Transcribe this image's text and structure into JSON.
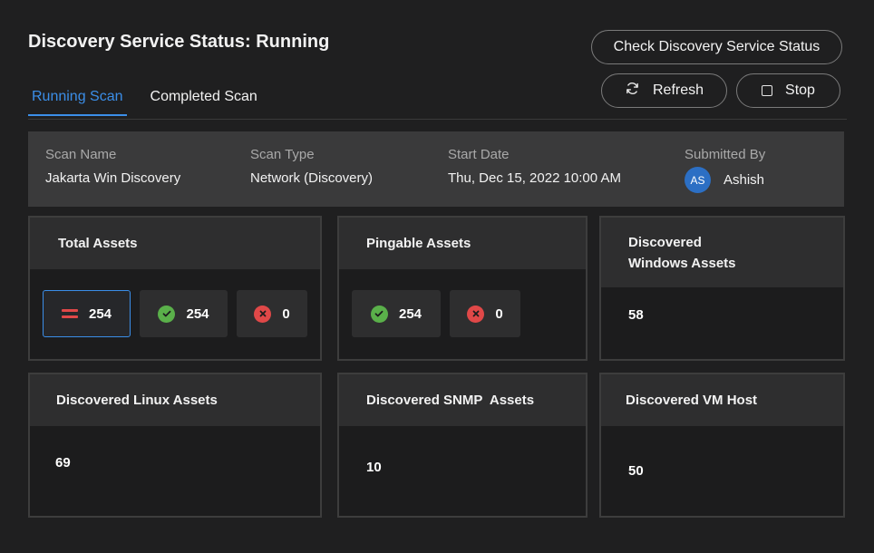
{
  "header": {
    "title": "Discovery Service Status: Running",
    "check_label": "Check Discovery Service Status",
    "refresh_label": "Refresh",
    "stop_label": "Stop"
  },
  "tabs": [
    {
      "label": "Running Scan",
      "active": true
    },
    {
      "label": "Completed Scan",
      "active": false
    }
  ],
  "scan_info": {
    "name_label": "Scan Name",
    "name_value": "Jakarta Win Discovery",
    "type_label": "Scan Type",
    "type_value": "Network (Discovery)",
    "date_label": "Start Date",
    "date_value": "Thu, Dec 15, 2022 10:00 AM",
    "submitted_label": "Submitted By",
    "submitted_initials": "AS",
    "submitted_value": "Ashish"
  },
  "cards": {
    "total": {
      "title": "Total Assets",
      "all": "254",
      "ok": "254",
      "failed": "0"
    },
    "pingable": {
      "title": "Pingable Assets",
      "ok": "254",
      "failed": "0"
    },
    "windows": {
      "title_line1": "Discovered",
      "title_line2": "Windows Assets",
      "value": "58"
    },
    "linux": {
      "title": "Discovered Linux Assets",
      "value": "69"
    },
    "snmp": {
      "title": "Discovered SNMP  Assets",
      "value": "10"
    },
    "vm": {
      "title": "Discovered VM Host",
      "value": "50"
    }
  },
  "colors": {
    "accent": "#3b8ee8",
    "ok": "#5ab04a",
    "error": "#e04848",
    "avatar": "#2c6fc4"
  }
}
